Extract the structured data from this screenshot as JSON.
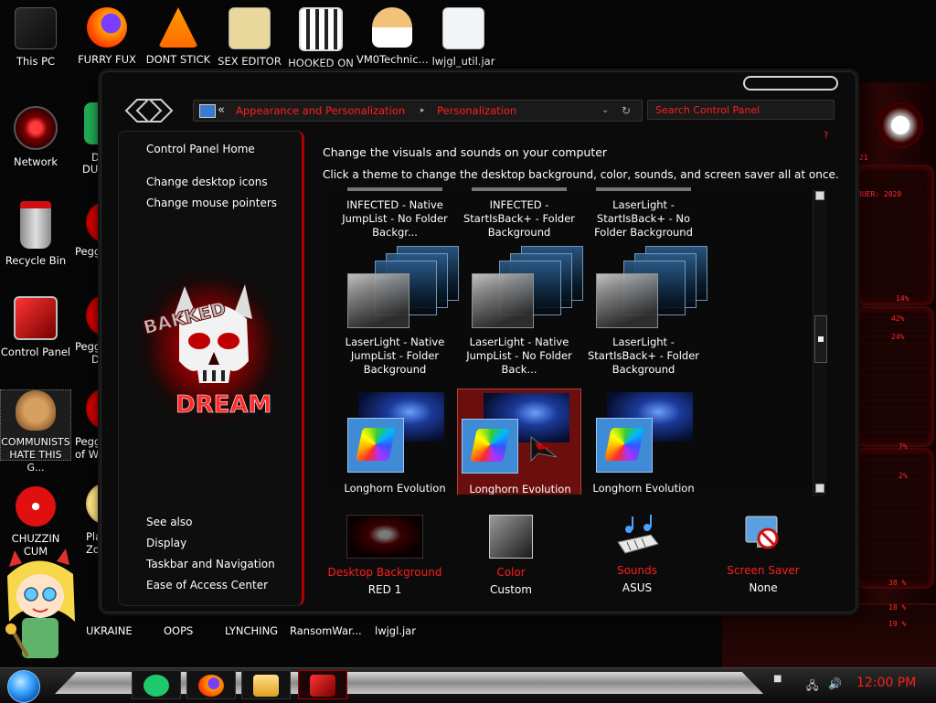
{
  "desktop": {
    "top_icons": [
      {
        "label": "This PC",
        "icon": "this-pc-icon",
        "color": "#1a1a1a"
      },
      {
        "label": "FURRY FUX",
        "icon": "firefox-icon",
        "color": "#ff6a00"
      },
      {
        "label": "DONT STICK",
        "icon": "vlc-cone-icon",
        "color": "#ff8800"
      },
      {
        "label": "SEX EDITOR",
        "icon": "hxd-editor-icon",
        "color": "#e6d08a"
      },
      {
        "label": "HOOKED ON",
        "icon": "maze-icon",
        "color": "#ffffff"
      },
      {
        "label": "VM0Technic...",
        "icon": "doctor-avatar-icon",
        "color": "#f0c080"
      },
      {
        "label": "lwjgl_util.jar",
        "icon": "java-jar-icon",
        "color": "#e8f0f8"
      }
    ],
    "left_icons": [
      {
        "label": "Network",
        "icon": "network-icon",
        "color": "#6b0000"
      },
      {
        "label": "Recycle Bin",
        "icon": "recycle-bin-icon",
        "color": "#c0c0c0"
      },
      {
        "label": "Control Panel",
        "icon": "control-panel-icon",
        "color": "#ff2222"
      },
      {
        "label": "COMMUNISTS HATE THIS G...",
        "icon": "money-bag-icon",
        "color": "#b08040"
      },
      {
        "label": "CHUZZIN CUM",
        "icon": "red-chuzzle-icon",
        "color": "#e01010"
      }
    ],
    "partial_labels": [
      "D",
      "DUI",
      "Pegg",
      "Pegg",
      "D",
      "Pegg",
      "of Wa",
      "Pla",
      "Zo"
    ],
    "bottom_labels": [
      "UKRAINE",
      "OOPS",
      "LYNCHING",
      "RansomWar...",
      "lwjgl.jar"
    ],
    "wall_readouts": [
      "21",
      "BUER: 2020",
      "14%",
      "42%",
      "24%",
      "7%",
      "2%",
      "38 %",
      "18 %",
      "19 %"
    ]
  },
  "window": {
    "address": {
      "separator": "«",
      "crumb1": "Appearance and Personalization",
      "crumb_arrow": "▸",
      "crumb2": "Personalization",
      "dropdown": "⌄",
      "refresh": "↻"
    },
    "search_placeholder": "Search Control Panel",
    "help": "?",
    "left_pane": {
      "home": "Control Panel Home",
      "links": [
        "Change desktop icons",
        "Change mouse pointers"
      ],
      "logo_alt": "BAKKED DREAM skull logo",
      "see_also": "See also",
      "see_also_links": [
        "Display",
        "Taskbar and Navigation",
        "Ease of Access Center"
      ]
    },
    "heading": "Change the visuals and sounds on your computer",
    "subheading": "Click a theme to change the desktop background, color, sounds, and screen saver all at once.",
    "themes_row1": [
      [
        "INFECTED - Native",
        "JumpList - No Folder",
        "Backgr..."
      ],
      [
        "INFECTED -",
        "StartIsBack+ - Folder",
        "Background"
      ],
      [
        "LaserLight -",
        "StartIsBack+ - No",
        "Folder Background"
      ]
    ],
    "themes_row2": [
      [
        "LaserLight - Native",
        "JumpList - Folder",
        "Background"
      ],
      [
        "LaserLight - Native",
        "JumpList - No Folder",
        "Back..."
      ],
      [
        "LaserLight -",
        "StartIsBack+ - Folder",
        "Background"
      ]
    ],
    "themes_row3": [
      "Longhorn Evolution",
      "Longhorn Evolution",
      "Longhorn Evolution"
    ],
    "selected_theme_index": 1,
    "bottom": [
      {
        "title": "Desktop Background",
        "value": "RED 1",
        "icon": "wallpaper-thumbnail-icon"
      },
      {
        "title": "Color",
        "value": "Custom",
        "icon": "color-swatch-icon"
      },
      {
        "title": "Sounds",
        "value": "ASUS",
        "icon": "music-keyboard-icon"
      },
      {
        "title": "Screen Saver",
        "value": "None",
        "icon": "screen-saver-icon"
      }
    ]
  },
  "taskbar": {
    "tray_icons": [
      "network-tray-icon",
      "volume-tray-icon"
    ],
    "clock": "12:00 PM"
  },
  "colors": {
    "accent_red": "#ff1e1e",
    "window_bg": "#0b0b0b",
    "selection_bg": "#6a0e0e"
  }
}
